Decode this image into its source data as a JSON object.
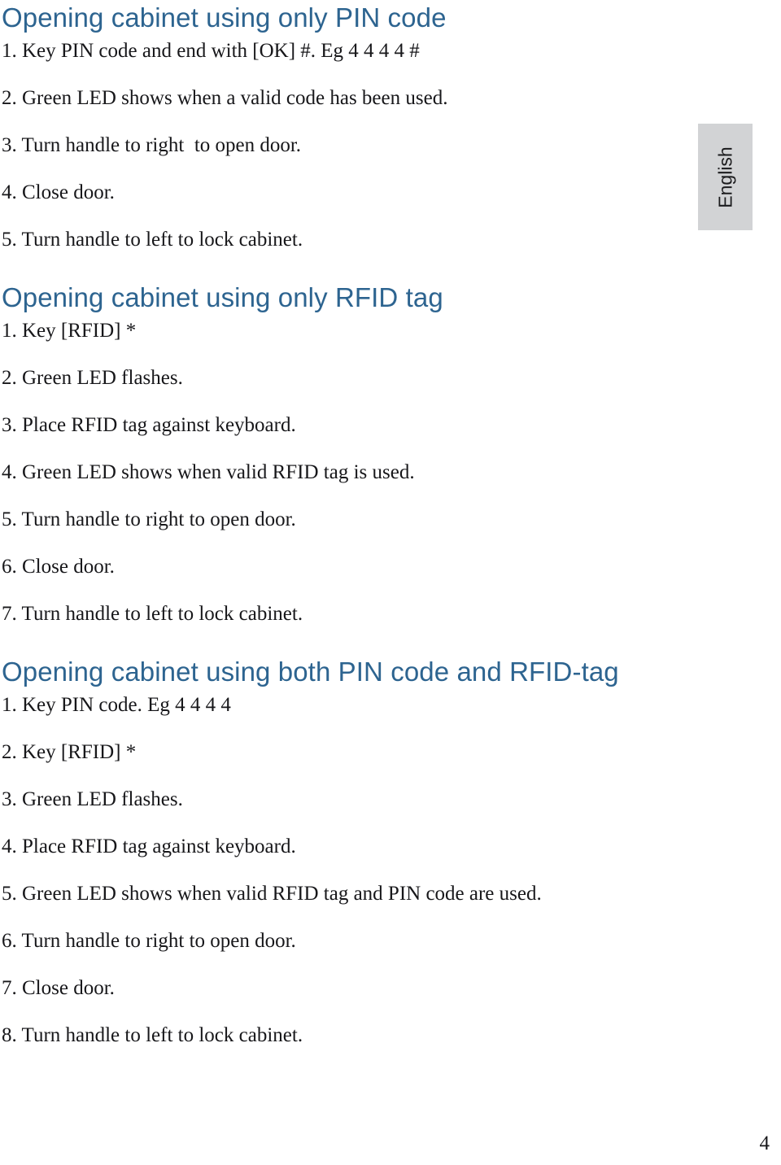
{
  "document": {
    "page_number": "4",
    "language_tab": "English",
    "accent_color": "#2d6490",
    "tab_background": "#d2d3d5",
    "body_color": "#17171a"
  },
  "sections": [
    {
      "title": "Opening cabinet using only PIN code",
      "steps": [
        "1. Key PIN code and end with [OK] #. Eg 4 4 4 4 #",
        "2. Green LED shows when a valid code has been used.",
        "3. Turn handle to right  to open door.",
        "4. Close door.",
        "5. Turn handle to left to lock cabinet."
      ]
    },
    {
      "title": "Opening cabinet using only RFID tag",
      "steps": [
        "1. Key [RFID] *",
        "2. Green LED flashes.",
        "3. Place RFID tag against keyboard.",
        "4. Green LED shows when valid RFID tag is used.",
        "5. Turn handle to right to open door.",
        "6. Close door.",
        "7. Turn handle to left to lock cabinet."
      ]
    },
    {
      "title": "Opening cabinet using both PIN code and RFID-tag",
      "steps": [
        "1. Key PIN code. Eg 4 4 4 4",
        "2. Key [RFID] *",
        "3. Green LED flashes.",
        "4. Place RFID tag against keyboard.",
        "5. Green LED shows when valid RFID tag and PIN code are used.",
        "6. Turn handle to right to open door.",
        "7. Close door.",
        "8. Turn handle to left to lock cabinet."
      ]
    }
  ]
}
